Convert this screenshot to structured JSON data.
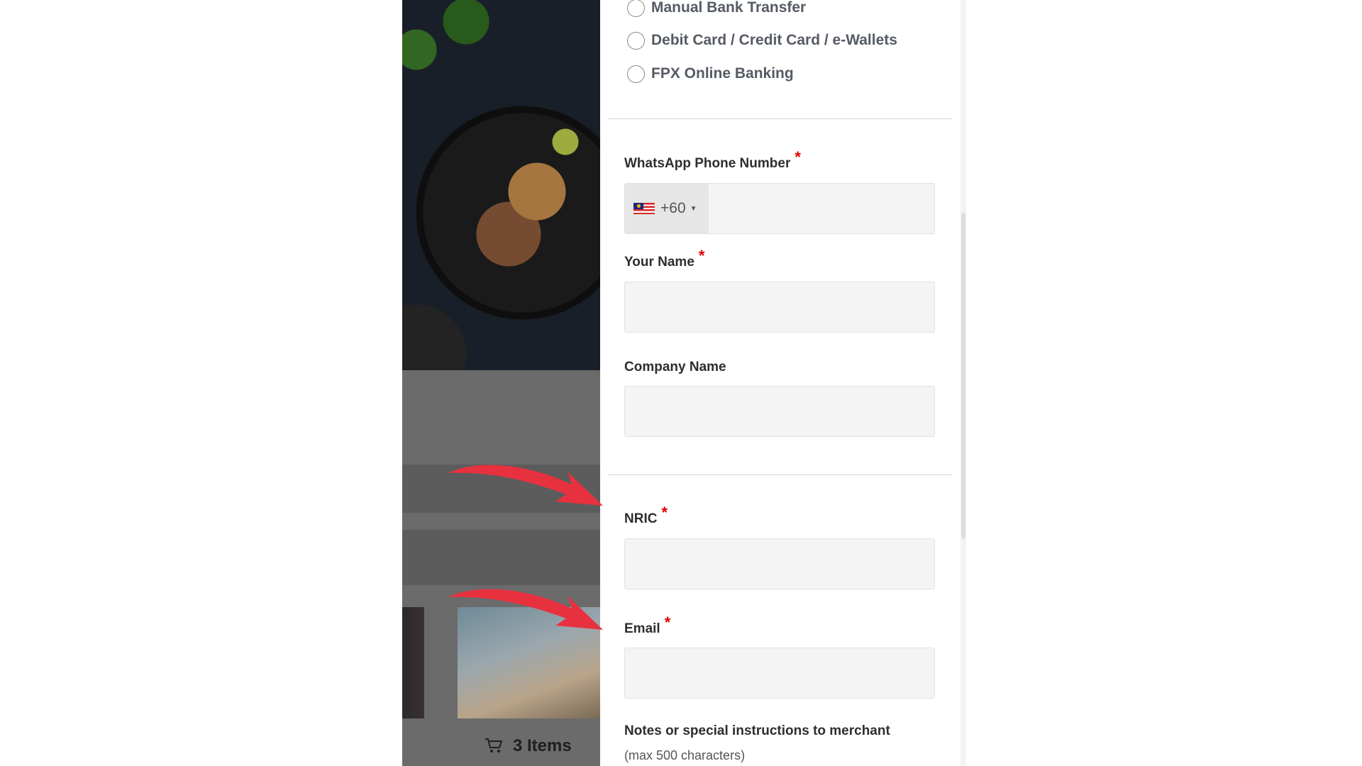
{
  "payment_methods": [
    {
      "label": "Manual Bank Transfer",
      "selected": false
    },
    {
      "label": "Debit Card / Credit Card / e-Wallets",
      "selected": false
    },
    {
      "label": "FPX Online Banking",
      "selected": false
    }
  ],
  "required_marker": "*",
  "fields": {
    "whatsapp": {
      "label": "WhatsApp Phone Number",
      "dial_code": "+60",
      "country_flag": "malaysia-flag-icon",
      "value": ""
    },
    "name": {
      "label": "Your Name",
      "value": ""
    },
    "company": {
      "label": "Company Name",
      "value": ""
    },
    "nric": {
      "label": "NRIC",
      "value": ""
    },
    "email": {
      "label": "Email",
      "value": ""
    }
  },
  "notes": {
    "label": "Notes or special instructions to merchant",
    "hint": "(max 500 characters)"
  },
  "cart": {
    "icon": "cart-icon",
    "count_label": "3 Items"
  },
  "colors": {
    "annotation_arrow": "#e8313f",
    "required": "#e00000",
    "overlay": "#6b6b6b"
  }
}
